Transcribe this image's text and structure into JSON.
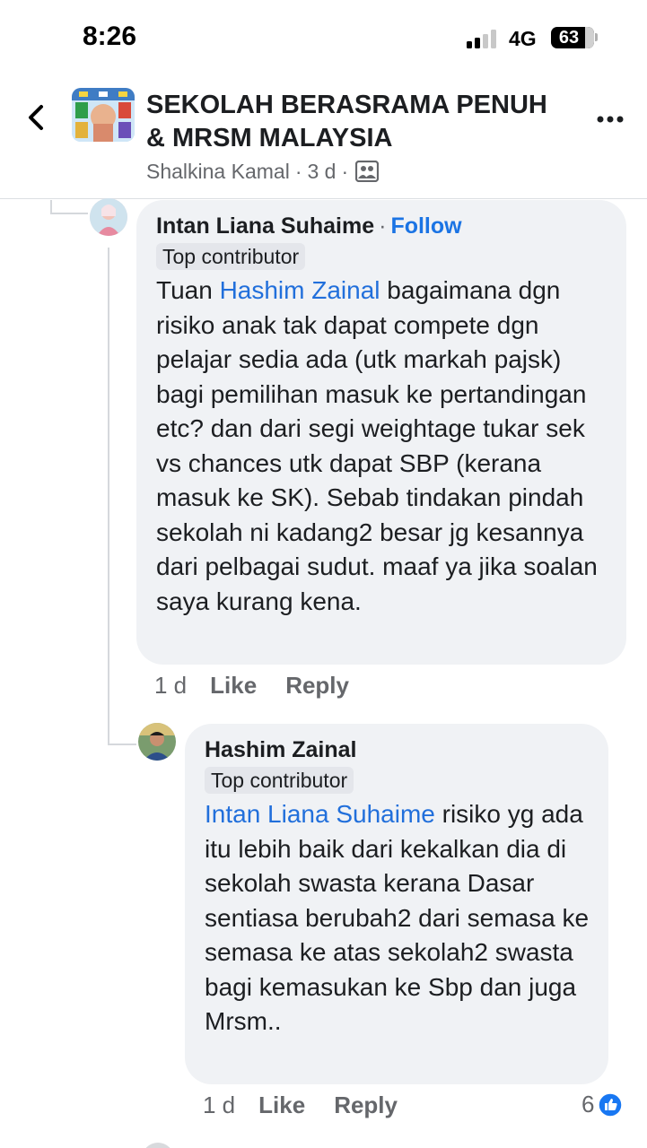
{
  "status_bar": {
    "time": "8:26",
    "network": "4G",
    "battery": "63"
  },
  "header": {
    "group_name": "SEKOLAH BERASRAMA PENUH & MRSM MALAYSIA",
    "poster": "Shalkina Kamal",
    "separator": "·",
    "time": "3 d",
    "audience_icon": "group-audience-icon",
    "back_icon": "chevron-left-icon",
    "more_icon": "more-dots-icon"
  },
  "comments": [
    {
      "author": "Intan Liana Suhaime",
      "dot": "·",
      "follow_label": "Follow",
      "badge": "Top contributor",
      "mention": "Hashim Zainal",
      "text_before": "Tuan ",
      "text_after": " bagaimana dgn risiko anak tak dapat compete dgn pelajar sedia ada (utk markah pajsk) bagi pemilihan masuk ke pertandingan etc? dan dari segi weightage tukar sek vs chances utk dapat SBP (kerana masuk ke SK). Sebab tindakan pindah sekolah ni kadang2 besar jg kesannya dari pelbagai sudut. maaf ya jika soalan saya kurang kena.",
      "time": "1 d",
      "like_label": "Like",
      "reply_label": "Reply"
    },
    {
      "author": "Hashim Zainal",
      "badge": "Top contributor",
      "mention": "Intan Liana Suhaime",
      "text_after": " risiko yg ada itu lebih baik dari kekalkan dia di sekolah swasta kerana Dasar sentiasa berubah2 dari semasa ke semasa ke atas sekolah2 swasta bagi kemasukan ke Sbp dan juga Mrsm..",
      "time": "1 d",
      "like_label": "Like",
      "reply_label": "Reply",
      "reaction_count": "6",
      "reaction_icon": "like-reaction-icon"
    }
  ],
  "colors": {
    "link_blue": "#216fdb",
    "follow_blue": "#1b74e4",
    "bubble_bg": "#f0f2f5",
    "meta_gray": "#65676b"
  }
}
